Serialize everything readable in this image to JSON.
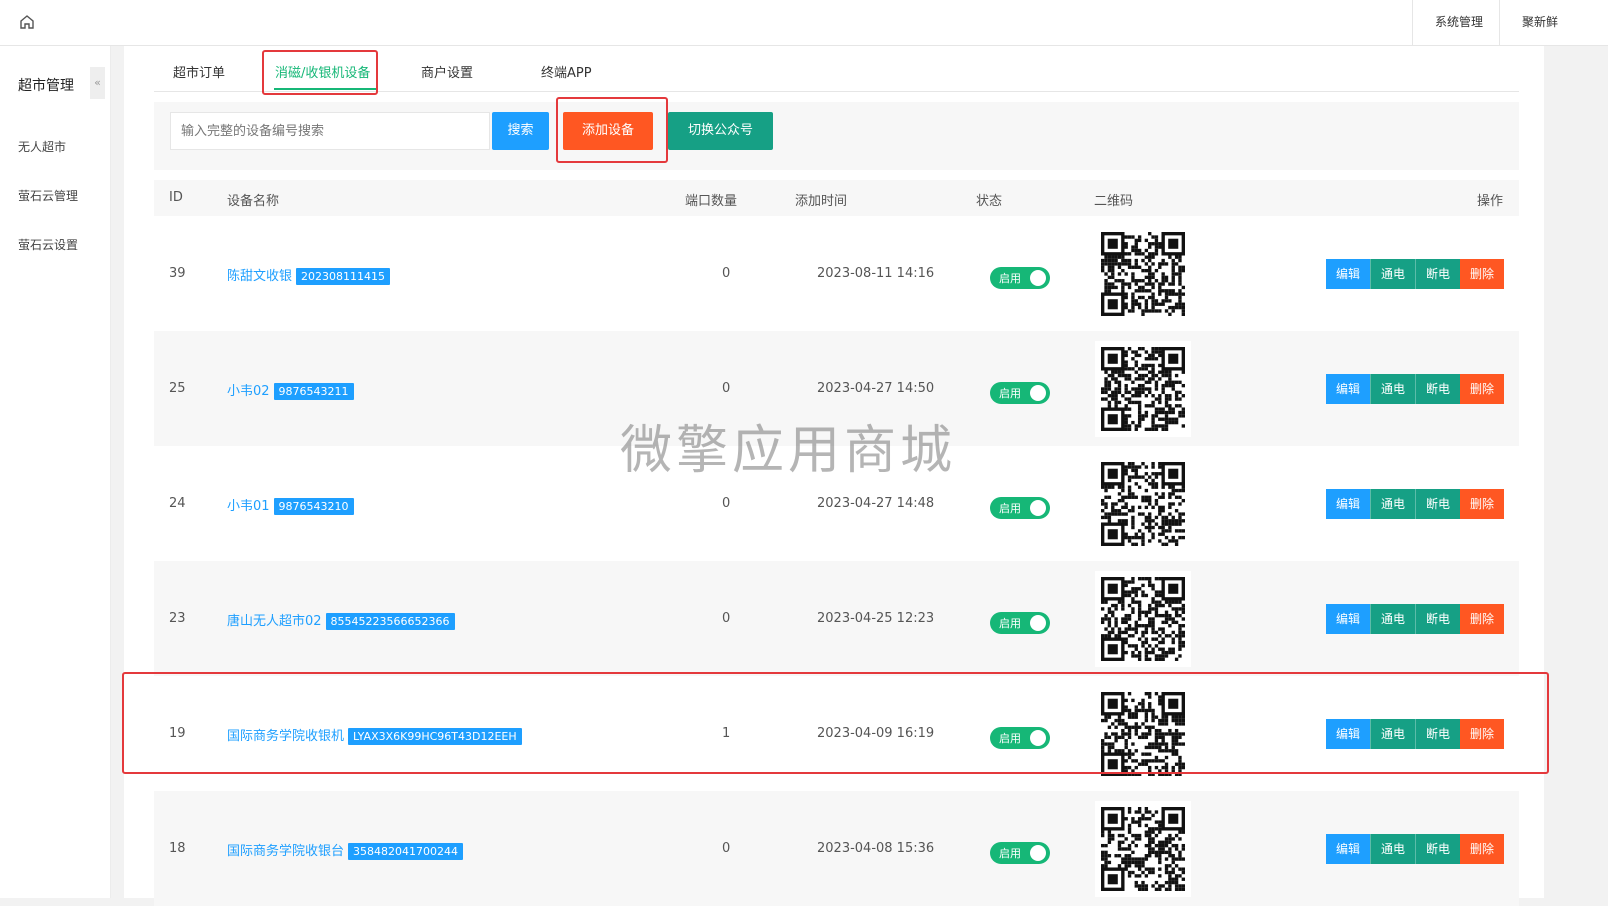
{
  "topbar": {
    "system_label": "系统管理",
    "user_label": "聚新鲜"
  },
  "sidebar": {
    "title": "超市管理",
    "collapse_glyph": "«",
    "items": [
      "无人超市",
      "萤石云管理",
      "萤石云设置"
    ]
  },
  "tabs": [
    "超市订单",
    "消磁/收银机设备",
    "商户设置",
    "终端APP"
  ],
  "toolbar": {
    "search_placeholder": "输入完整的设备编号搜索",
    "search_label": "搜索",
    "add_label": "添加设备",
    "switch_label": "切换公众号"
  },
  "table": {
    "headers": [
      "ID",
      "设备名称",
      "端口数量",
      "添加时间",
      "状态",
      "二维码",
      "操作"
    ],
    "rows": [
      {
        "id": "39",
        "name": "陈甜文收银",
        "code": "202308111415",
        "ports": "0",
        "time": "2023-08-11 14:16",
        "status": "启用"
      },
      {
        "id": "25",
        "name": "小韦02",
        "code": "9876543211",
        "ports": "0",
        "time": "2023-04-27 14:50",
        "status": "启用"
      },
      {
        "id": "24",
        "name": "小韦01",
        "code": "9876543210",
        "ports": "0",
        "time": "2023-04-27 14:48",
        "status": "启用"
      },
      {
        "id": "23",
        "name": "唐山无人超市02",
        "code": "85545223566652366",
        "ports": "0",
        "time": "2023-04-25 12:23",
        "status": "启用"
      },
      {
        "id": "19",
        "name": "国际商务学院收银机",
        "code": "LYAX3X6K99HC96T43D12EEH",
        "ports": "1",
        "time": "2023-04-09 16:19",
        "status": "启用"
      },
      {
        "id": "18",
        "name": "国际商务学院收银台",
        "code": "358482041700244",
        "ports": "0",
        "time": "2023-04-08 15:36",
        "status": "启用"
      }
    ],
    "actions": {
      "edit": "编辑",
      "power_on": "通电",
      "power_off": "断电",
      "delete": "删除"
    }
  },
  "watermark": "微擎应用商城",
  "colors": {
    "accent_green": "#16b777",
    "blue": "#1e9fff",
    "teal": "#16a085",
    "orange": "#ff5722",
    "highlight_red": "#e4393c"
  }
}
